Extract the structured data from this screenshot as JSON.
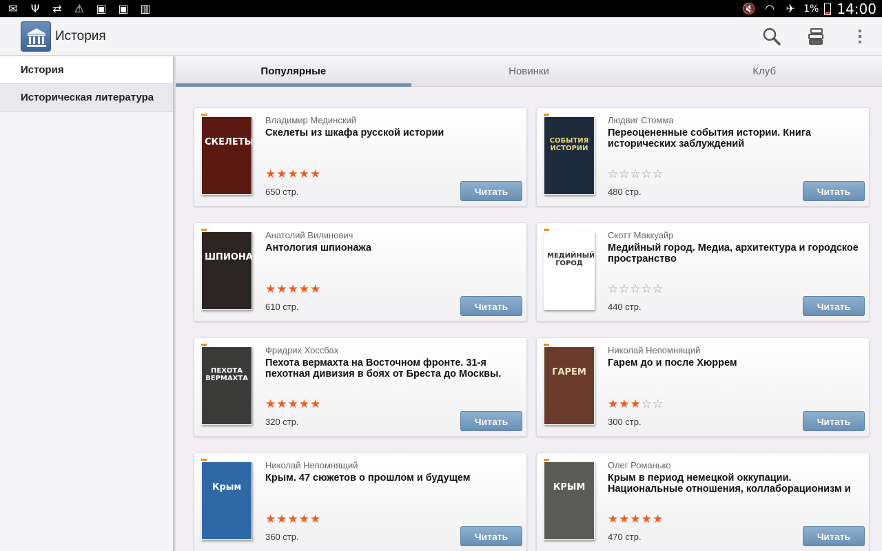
{
  "status_bar": {
    "battery_percent": "1%",
    "time": "14:00",
    "left_icons": [
      "mail-icon",
      "usb-icon",
      "sync-icon",
      "warning-icon",
      "download-icon",
      "download-icon",
      "storage-icon"
    ],
    "right_icons": [
      "mute-icon",
      "wifi-icon",
      "airplane-icon"
    ]
  },
  "app_bar": {
    "title": "История",
    "actions": [
      "search-icon",
      "library-icon",
      "overflow-menu-icon"
    ]
  },
  "sidebar": {
    "items": [
      {
        "label": "История"
      },
      {
        "label": "Историческая литература"
      }
    ]
  },
  "tabs": [
    {
      "label": "Популярные",
      "active": true
    },
    {
      "label": "Новинки",
      "active": false
    },
    {
      "label": "Клуб",
      "active": false
    }
  ],
  "read_label": "Читать",
  "books": [
    {
      "author": "Владимир Мединский",
      "title": "Скелеты из шкафа русской истории",
      "rating": 5,
      "pages": "650 стр.",
      "cover_text": "СКЕЛЕТЫ",
      "cover_bg": "#5a1a12",
      "cover_fg": "#ffffff"
    },
    {
      "author": "Людвиг Стомма",
      "title": "Переоцененные события истории. Книга исторических заблуждений",
      "rating": 0,
      "pages": "480 стр.",
      "cover_text": "СОБЫТИЯ ИСТОРИИ",
      "cover_bg": "#1e2b3a",
      "cover_fg": "#e9d37a"
    },
    {
      "author": "Анатолий Вилинович",
      "title": "Антология шпионажа",
      "rating": 5,
      "pages": "610 стр.",
      "cover_text": "ШПИОНАЖА",
      "cover_bg": "#2a2522",
      "cover_fg": "#ffffff"
    },
    {
      "author": "Скотт Маккуайр",
      "title": "Медийный город. Медиа, архитектура и городское пространство",
      "rating": 0,
      "pages": "440 стр.",
      "cover_text": "МЕДИЙНЫЙ ГОРОД",
      "cover_bg": "#ffffff",
      "cover_fg": "#333333"
    },
    {
      "author": "Фридрих Хоссбах",
      "title": "Пехота вермахта на Восточном фронте. 31-я пехотная дивизия в боях от Бреста до Москвы.",
      "rating": 5,
      "pages": "320 стр.",
      "cover_text": "ПЕХОТА ВЕРМАХТА",
      "cover_bg": "#3a3a38",
      "cover_fg": "#ffffff"
    },
    {
      "author": "Николай Непомнящий",
      "title": "Гарем до и после Хюррем",
      "rating": 3,
      "pages": "300 стр.",
      "cover_text": "ГАРЕМ",
      "cover_bg": "#6a3b2a",
      "cover_fg": "#f1e2c0"
    },
    {
      "author": "Николай Непомнящий",
      "title": "Крым. 47 сюжетов о прошлом и будущем",
      "rating": 5,
      "pages": "360 стр.",
      "cover_text": "Крым",
      "cover_bg": "#2f68a6",
      "cover_fg": "#ffffff"
    },
    {
      "author": "Олег Романько",
      "title": "Крым в период немецкой оккупации. Национальные отношения, коллаборационизм и",
      "rating": 5,
      "pages": "470 стр.",
      "cover_text": "КРЫМ",
      "cover_bg": "#5b5b58",
      "cover_fg": "#ffffff"
    }
  ],
  "colors": {
    "accent": "#6f8fa9",
    "star_on": "#f05a1e",
    "button": "#7aa0c4"
  }
}
